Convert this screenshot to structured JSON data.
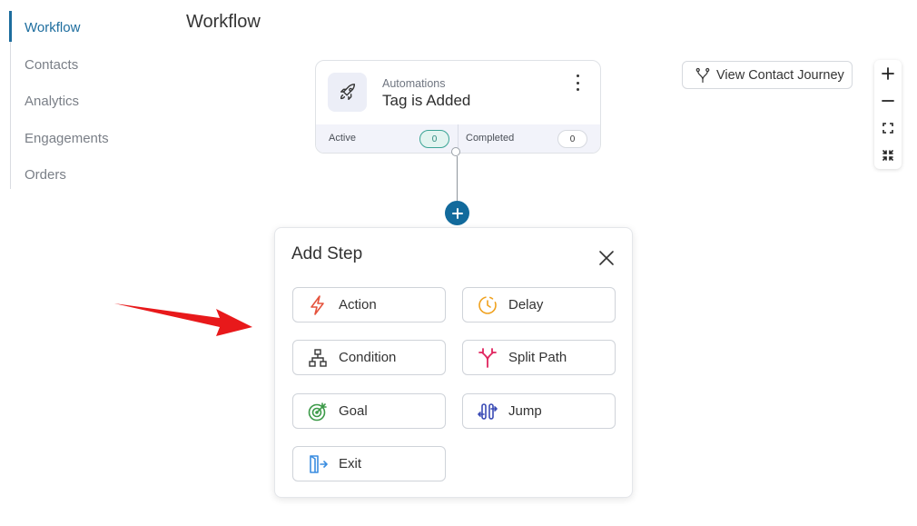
{
  "sidebar": {
    "items": [
      {
        "label": "Workflow",
        "active": true
      },
      {
        "label": "Contacts",
        "active": false
      },
      {
        "label": "Analytics",
        "active": false
      },
      {
        "label": "Engagements",
        "active": false
      },
      {
        "label": "Orders",
        "active": false
      }
    ]
  },
  "page": {
    "title": "Workflow"
  },
  "trigger": {
    "category": "Automations",
    "title": "Tag is Added",
    "icon": "rocket-icon",
    "stats": {
      "active_label": "Active",
      "active_count": "0",
      "completed_label": "Completed",
      "completed_count": "0"
    }
  },
  "toolbar": {
    "journey_label": "View Contact Journey"
  },
  "add_step": {
    "title": "Add Step",
    "options": [
      {
        "label": "Action",
        "icon": "bolt-icon",
        "color": "#e5533d"
      },
      {
        "label": "Delay",
        "icon": "clock-icon",
        "color": "#f0a21f"
      },
      {
        "label": "Condition",
        "icon": "hierarchy-icon",
        "color": "#353535"
      },
      {
        "label": "Split Path",
        "icon": "split-icon",
        "color": "#e0245e"
      },
      {
        "label": "Goal",
        "icon": "target-icon",
        "color": "#3c9a48"
      },
      {
        "label": "Jump",
        "icon": "jump-icon",
        "color": "#3a4bb5"
      },
      {
        "label": "Exit",
        "icon": "exit-icon",
        "color": "#3b8de0"
      }
    ]
  },
  "colors": {
    "brand": "#126a9c",
    "sidebar_active": "#1d6d9e",
    "annotation_arrow": "#e8191b"
  }
}
